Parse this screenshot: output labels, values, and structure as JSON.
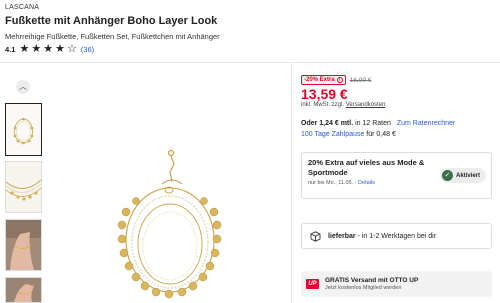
{
  "product": {
    "brand": "LASCANA",
    "title": "Fußkette mit Anhänger Boho Layer Look",
    "subtitle": "Mehrreihige Fußkette, Fußketten Set, Fußkettchen mit Anhänger",
    "rating": "4.1",
    "rating_stars": 4,
    "rating_count": "(36)"
  },
  "gallery": {
    "scroll_up_icon": "chevron-up-icon",
    "thumbnails": [
      {
        "name": "anklet-closeup",
        "selected": true
      },
      {
        "name": "anklet-layers",
        "selected": false
      },
      {
        "name": "anklet-worn-left",
        "selected": false
      },
      {
        "name": "anklet-worn-right",
        "selected": false
      }
    ]
  },
  "pricing": {
    "discount_badge": "-20% Extra",
    "old_price": "16,99 €",
    "price": "13,59 €",
    "tax_prefix": "inkl. MwSt. zzgl.",
    "shipping_link": "Versandkosten",
    "installment_bold": "Oder 1,24 € mtl.",
    "installment_rest": "in 12 Raten",
    "installment_link": "Zum Ratenrechner",
    "payment_link": "100 Tage Zahlpause",
    "payment_rest": "für 0,48 €"
  },
  "promo": {
    "title": "20% Extra auf vieles aus Mode & Sportmode",
    "sub_prefix": "nur bis Mo., 11.05. -",
    "sub_link": "Details",
    "activated_label": "Aktiviert"
  },
  "delivery": {
    "status_bold": "lieferbar",
    "status_rest": "- in 1-2 Werktagen bei dir"
  },
  "ottoup": {
    "logo_text": "UP",
    "title": "GRATIS Versand mit OTTO UP",
    "subtitle": "Jetzt kostenlos Mitglied werden"
  },
  "colors": {
    "sale_red": "#e4002b",
    "link_blue": "#2a5bd7",
    "check_green": "#3c6e47",
    "gold": "#c9a24a"
  }
}
